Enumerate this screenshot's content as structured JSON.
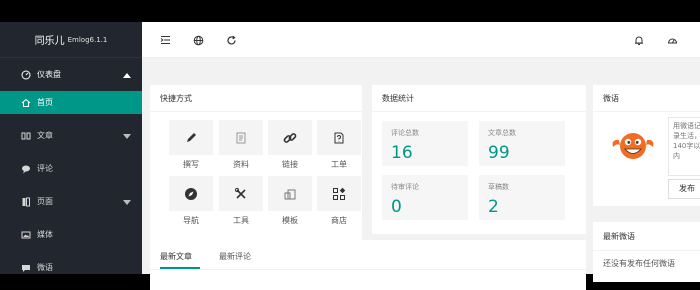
{
  "brand": {
    "name": "同乐儿",
    "version": "Emlog6.1.1"
  },
  "sidebar": {
    "items": [
      {
        "label": "仪表盘"
      },
      {
        "label": "首页"
      },
      {
        "label": "文章"
      },
      {
        "label": "评论"
      },
      {
        "label": "页面"
      },
      {
        "label": "媒体"
      },
      {
        "label": "微语"
      }
    ]
  },
  "shortcuts": {
    "title": "快捷方式",
    "items": [
      {
        "label": "撰写"
      },
      {
        "label": "资料"
      },
      {
        "label": "链接"
      },
      {
        "label": "工单"
      },
      {
        "label": "导航"
      },
      {
        "label": "工具"
      },
      {
        "label": "模板"
      },
      {
        "label": "商店"
      }
    ]
  },
  "stats": {
    "title": "数据统计",
    "items": [
      {
        "label": "评论总数",
        "value": "16"
      },
      {
        "label": "文章总数",
        "value": "99"
      },
      {
        "label": "待审评论",
        "value": "0"
      },
      {
        "label": "草稿数",
        "value": "2"
      }
    ]
  },
  "weiyu": {
    "title": "微语",
    "placeholder": "用微语记录生活，140字以内",
    "button": "发布"
  },
  "latest_weiyu": {
    "title": "最新微语",
    "empty": "还没有发布任何微语"
  },
  "tabs": {
    "articles": "最新文章",
    "comments": "最新评论"
  },
  "colors": {
    "accent": "#009688",
    "sidebar": "#22262e",
    "avatar": "#f26d21"
  }
}
